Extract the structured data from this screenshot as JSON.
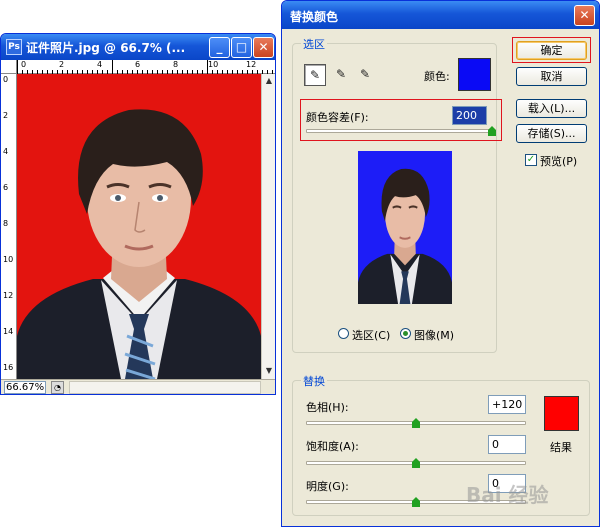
{
  "doc_window": {
    "title": "证件照片.jpg @ 66.7% (...",
    "minimize_glyph": "_",
    "maximize_glyph": "□",
    "close_glyph": "✕",
    "zoom": "66.67%",
    "ruler_top": [
      "0",
      "2",
      "4",
      "6",
      "8",
      "10",
      "12"
    ],
    "ruler_left": [
      "0",
      "2",
      "4",
      "6",
      "8",
      "10",
      "12",
      "14",
      "16"
    ],
    "canvas_color": "#e3140f"
  },
  "dialog": {
    "title": "替换颜色",
    "close_glyph": "✕",
    "selection": {
      "group_label": "选区",
      "color_label": "颜色:",
      "color_value": "#0a0af5",
      "tolerance_label": "颜色容差(F):",
      "tolerance_value": "200",
      "tolerance_fraction": 1.0,
      "radio_selection": "选区(C)",
      "radio_image": "图像(M)",
      "selected_radio": "image",
      "preview_bg": "#1d1df7"
    },
    "buttons": {
      "ok": "确定",
      "cancel": "取消",
      "load": "载入(L)...",
      "save": "存储(S)..."
    },
    "preview_label": "预览(P)",
    "preview_checked": true,
    "replace": {
      "group_label": "替换",
      "hue_label": "色相(H):",
      "hue_value": "+120",
      "hue_fraction": 0.5,
      "saturation_label": "饱和度(A):",
      "saturation_value": "0",
      "saturation_fraction": 0.5,
      "lightness_label": "明度(G):",
      "lightness_value": "0",
      "lightness_fraction": 0.5,
      "result_label": "结果",
      "result_color": "#ff0000"
    }
  },
  "watermark": "Bai 经验"
}
